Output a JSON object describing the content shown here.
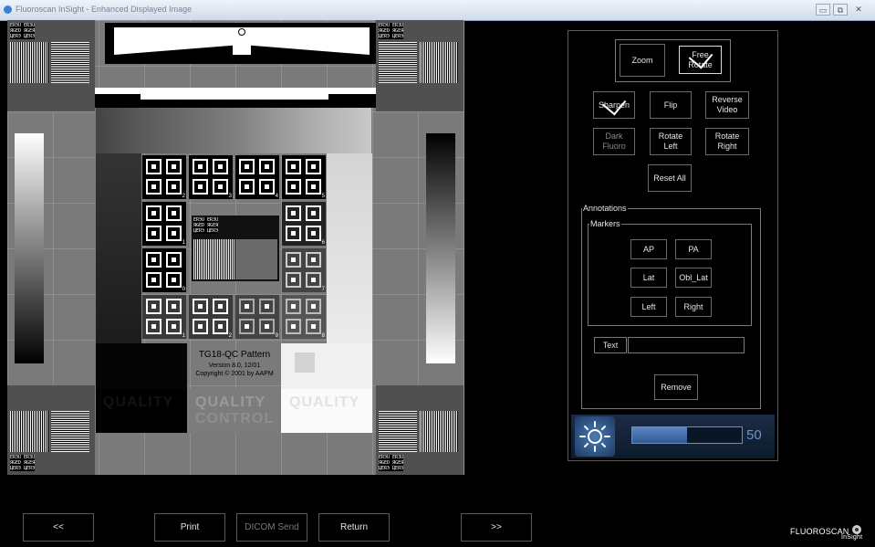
{
  "window": {
    "title": "Fluoroscan InSight - Enhanced Displayed Image",
    "minimize_glyph": "▭",
    "restore_glyph": "⧉",
    "close_glyph": "✕"
  },
  "image": {
    "pattern_title": "TG18-QC Pattern",
    "pattern_version": "Version 8.0, 12/01",
    "pattern_copyright": "Copyright © 2001 by AAPM",
    "quality_text": "QUALITY",
    "control_text": "CONTROL",
    "microtext": "ERЭU ЕR3U\nЯGED ЯGEЯ\nЦERЭ ЦERЭ",
    "patch_numbers": [
      "2",
      "3",
      "4",
      "5",
      "1",
      "6",
      "0",
      "7",
      "1",
      "2",
      "9",
      "8"
    ]
  },
  "controls": {
    "zoom": "Zoom",
    "free_rotate": "Free\nRotate",
    "sharpen": "Sharpen",
    "flip": "Flip",
    "reverse_video": "Reverse\nVideo",
    "dark_fluoro": "Dark\nFluoro",
    "rotate_left": "Rotate\nLeft",
    "rotate_right": "Rotate\nRight",
    "reset_all": "Reset All",
    "annotations_label": "Annotations",
    "markers_label": "Markers",
    "markers": {
      "ap": "AP",
      "pa": "PA",
      "lat": "Lat",
      "obl_lat": "Obl_Lat",
      "left": "Left",
      "right": "Right"
    },
    "text_label": "Text",
    "text_value": "",
    "remove": "Remove",
    "brightness_value": "50",
    "brightness_fraction": 0.5,
    "active_toggles": [
      "free_rotate",
      "sharpen"
    ]
  },
  "bottom": {
    "prev": "<<",
    "print": "Print",
    "dicom_send": "DICOM Send",
    "return": "Return",
    "next": ">>",
    "logo_main": "FLUOROSCAN",
    "logo_sub": "InSight"
  },
  "colors": {
    "accent": "#6a95cc",
    "titlebar": "#dbe5f1"
  }
}
